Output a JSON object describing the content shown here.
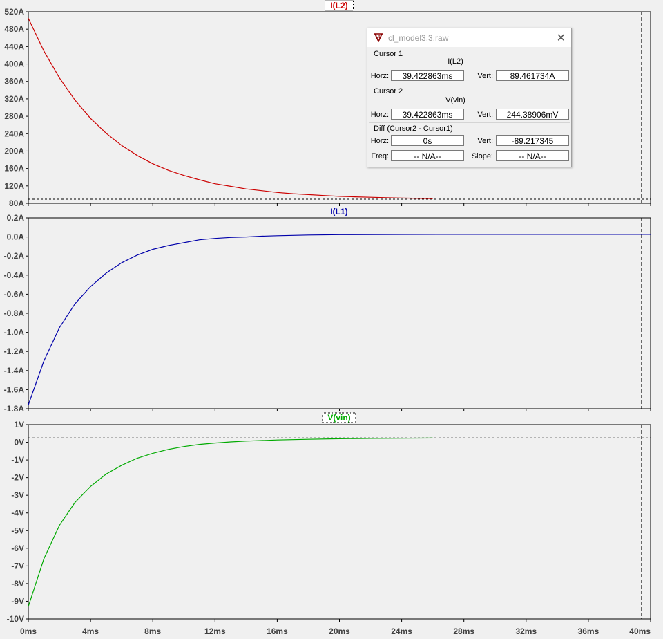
{
  "x_axis": {
    "tick_labels": [
      "0ms",
      "4ms",
      "8ms",
      "12ms",
      "16ms",
      "20ms",
      "24ms",
      "28ms",
      "32ms",
      "36ms",
      "40ms"
    ],
    "range": [
      0,
      40
    ],
    "unit": "ms"
  },
  "panes": [
    {
      "title": "I(L2)",
      "color": "#cc0000",
      "tick_labels": [
        "520A",
        "480A",
        "440A",
        "400A",
        "360A",
        "320A",
        "280A",
        "240A",
        "200A",
        "160A",
        "120A",
        "80A"
      ],
      "ylim": [
        80,
        520
      ]
    },
    {
      "title": "I(L1)",
      "color": "#0000aa",
      "tick_labels": [
        "0.2A",
        "0.0A",
        "-0.2A",
        "-0.4A",
        "-0.6A",
        "-0.8A",
        "-1.0A",
        "-1.2A",
        "-1.4A",
        "-1.6A",
        "-1.8A"
      ],
      "ylim": [
        -1.8,
        0.2
      ]
    },
    {
      "title": "V(vin)",
      "color": "#00aa00",
      "tick_labels": [
        "1V",
        "0V",
        "-1V",
        "-2V",
        "-3V",
        "-4V",
        "-5V",
        "-6V",
        "-7V",
        "-8V",
        "-9V",
        "-10V"
      ],
      "ylim": [
        -10,
        1
      ]
    }
  ],
  "chart_data": [
    {
      "type": "line",
      "title": "I(L2)",
      "xlabel": "",
      "ylabel": "",
      "xlim": [
        0,
        40
      ],
      "ylim": [
        80,
        520
      ],
      "grid": false,
      "series": [
        {
          "name": "I(L2)",
          "color": "#cc0000",
          "x": [
            0,
            1,
            2,
            3,
            4,
            5,
            6,
            7,
            8,
            9,
            10,
            11,
            12,
            13,
            14,
            15,
            16,
            17,
            18,
            19,
            20,
            21,
            22,
            23,
            24,
            26
          ],
          "y": [
            505,
            430,
            368,
            317,
            275,
            241,
            213,
            190,
            171,
            156,
            144,
            134,
            125,
            119,
            113,
            109,
            105,
            102,
            100,
            98,
            96,
            95,
            94,
            93,
            92,
            91
          ]
        }
      ],
      "cursor_level": 89.46,
      "cursor_x": 39.42
    },
    {
      "type": "line",
      "title": "I(L1)",
      "xlabel": "",
      "ylabel": "",
      "xlim": [
        0,
        40
      ],
      "ylim": [
        -1.8,
        0.2
      ],
      "grid": false,
      "series": [
        {
          "name": "I(L1)",
          "color": "#0000aa",
          "x": [
            0,
            1,
            2,
            3,
            4,
            5,
            6,
            7,
            8,
            9,
            10,
            11,
            12,
            13,
            14,
            15,
            16,
            18,
            20,
            24,
            28,
            32,
            36,
            40
          ],
          "y": [
            -1.76,
            -1.3,
            -0.95,
            -0.7,
            -0.52,
            -0.38,
            -0.27,
            -0.19,
            -0.13,
            -0.09,
            -0.06,
            -0.03,
            -0.015,
            -0.005,
            0.0,
            0.008,
            0.013,
            0.02,
            0.024,
            0.026,
            0.027,
            0.027,
            0.027,
            0.027
          ]
        }
      ],
      "cursor_x": 39.42
    },
    {
      "type": "line",
      "title": "V(vin)",
      "xlabel": "",
      "ylabel": "",
      "xlim": [
        0,
        40
      ],
      "ylim": [
        -10,
        1
      ],
      "grid": false,
      "series": [
        {
          "name": "V(vin)",
          "color": "#00aa00",
          "x": [
            0,
            1,
            2,
            3,
            4,
            5,
            6,
            7,
            8,
            9,
            10,
            11,
            12,
            13,
            14,
            15,
            16,
            18,
            20,
            22,
            24,
            26
          ],
          "y": [
            -9.3,
            -6.6,
            -4.7,
            -3.4,
            -2.5,
            -1.8,
            -1.3,
            -0.9,
            -0.62,
            -0.4,
            -0.24,
            -0.12,
            -0.04,
            0.02,
            0.07,
            0.1,
            0.13,
            0.17,
            0.2,
            0.22,
            0.23,
            0.24
          ]
        }
      ],
      "cursor_level": 0.244,
      "cursor_x": 39.42
    }
  ],
  "dialog": {
    "title": "cl_model3.3.raw",
    "cursor1": {
      "heading": "Cursor 1",
      "trace": "I(L2)",
      "horz_label": "Horz:",
      "horz_value": "39.422863ms",
      "vert_label": "Vert:",
      "vert_value": "89.461734A"
    },
    "cursor2": {
      "heading": "Cursor 2",
      "trace": "V(vin)",
      "horz_label": "Horz:",
      "horz_value": "39.422863ms",
      "vert_label": "Vert:",
      "vert_value": "244.38906mV"
    },
    "diff": {
      "heading": "Diff (Cursor2 - Cursor1)",
      "horz_label": "Horz:",
      "horz_value": "0s",
      "vert_label": "Vert:",
      "vert_value": "-89.217345",
      "freq_label": "Freq:",
      "freq_value": "-- N/A--",
      "slope_label": "Slope:",
      "slope_value": "-- N/A--"
    }
  }
}
